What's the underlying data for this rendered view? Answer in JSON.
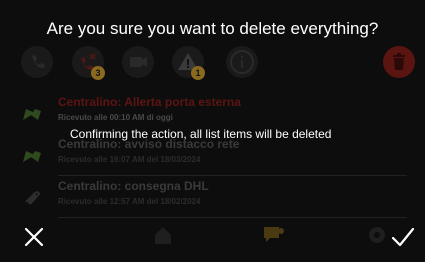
{
  "dialog": {
    "title": "Are you sure you want to delete everything?",
    "message": "Confirming the action, all list items will be deleted",
    "cancel_icon": "close-icon",
    "confirm_icon": "check-icon"
  },
  "toolbar": {
    "buttons": [
      {
        "icon": "phone-icon"
      },
      {
        "icon": "missed-call-icon",
        "badge": "3"
      },
      {
        "icon": "video-icon"
      },
      {
        "icon": "warning-icon",
        "badge": "1"
      },
      {
        "icon": "info-icon"
      },
      {
        "icon": "trash-icon"
      }
    ]
  },
  "list": {
    "items": [
      {
        "title": "Centralino: Allerta porta esterna",
        "subtitle": "Ricevuto alle 00:10 AM di oggi",
        "icon": "envelope-icon"
      },
      {
        "title": "Centralino: avviso distacco rete",
        "subtitle": "Ricevuto alle 16:07 AM del 18/03/2024",
        "icon": "envelope-icon"
      },
      {
        "title": "Centralino: consegna DHL",
        "subtitle": "Ricevuto alle 12:57 AM del 18/02/2024",
        "icon": "paperclip-icon"
      }
    ]
  },
  "bottom_nav": {
    "items": [
      {
        "icon": "home-icon"
      },
      {
        "icon": "messages-icon"
      },
      {
        "icon": "settings-icon"
      }
    ]
  },
  "colors": {
    "background": "#0d0d0d",
    "text": "#ffffff",
    "alert": "#5c1512",
    "trash": "#5a1511"
  }
}
